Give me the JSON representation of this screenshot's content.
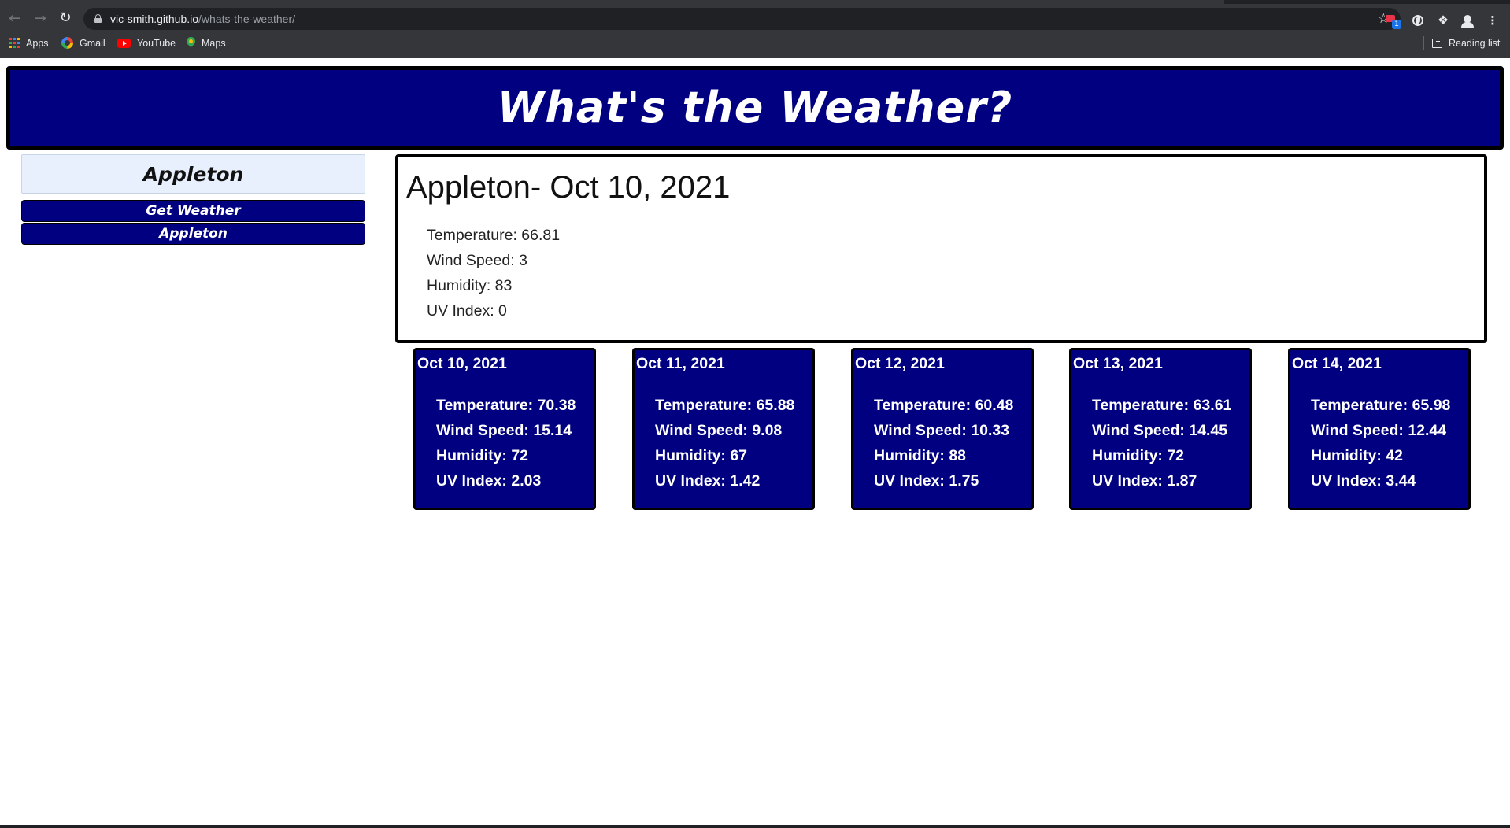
{
  "browser": {
    "url_host": "vic-smith.github.io",
    "url_path": "/whats-the-weather/",
    "bookmarks": [
      {
        "label": "Apps",
        "icon": "apps-grid-icon"
      },
      {
        "label": "Gmail",
        "icon": "google-icon"
      },
      {
        "label": "YouTube",
        "icon": "youtube-icon"
      },
      {
        "label": "Maps",
        "icon": "maps-icon"
      }
    ],
    "reading_list": "Reading list",
    "extension_badge": "1"
  },
  "header": {
    "title": "What's the Weather?"
  },
  "search": {
    "value": "Appleton"
  },
  "buttons": {
    "get_weather": "Get Weather",
    "history": [
      "Appleton"
    ]
  },
  "current": {
    "title": "Appleton- Oct 10, 2021",
    "temperature": "Temperature: 66.81",
    "wind": "Wind Speed: 3",
    "humidity": "Humidity: 83",
    "uv": "UV Index: 0"
  },
  "forecast": [
    {
      "date": "Oct 10, 2021",
      "temperature": "Temperature: 70.38",
      "wind": "Wind Speed: 15.14",
      "humidity": "Humidity: 72",
      "uv": "UV Index: 2.03"
    },
    {
      "date": "Oct 11, 2021",
      "temperature": "Temperature: 65.88",
      "wind": "Wind Speed: 9.08",
      "humidity": "Humidity: 67",
      "uv": "UV Index: 1.42"
    },
    {
      "date": "Oct 12, 2021",
      "temperature": "Temperature: 60.48",
      "wind": "Wind Speed: 10.33",
      "humidity": "Humidity: 88",
      "uv": "UV Index: 1.75"
    },
    {
      "date": "Oct 13, 2021",
      "temperature": "Temperature: 63.61",
      "wind": "Wind Speed: 14.45",
      "humidity": "Humidity: 72",
      "uv": "UV Index: 1.87"
    },
    {
      "date": "Oct 14, 2021",
      "temperature": "Temperature: 65.98",
      "wind": "Wind Speed: 12.44",
      "humidity": "Humidity: 42",
      "uv": "UV Index: 3.44"
    }
  ],
  "colors": {
    "brand_navy": "#000080",
    "input_bg": "#e8f0fe",
    "chrome_dark": "#35363a"
  }
}
